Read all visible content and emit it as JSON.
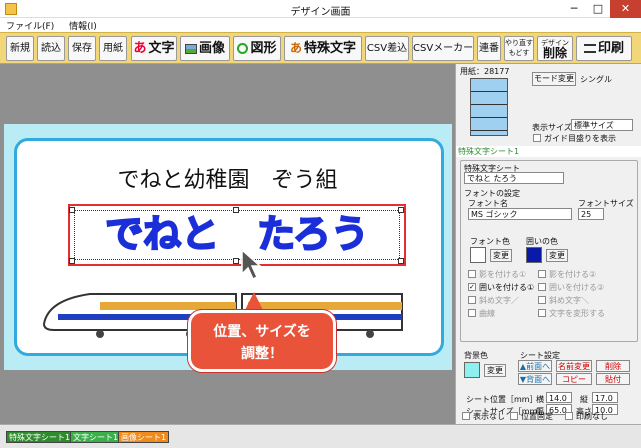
{
  "window": {
    "title": "デザイン画面",
    "minimize": "─",
    "maximize": "□",
    "close": "✕"
  },
  "menu": [
    "ファイル(F)",
    "情報(I)"
  ],
  "toolbar": {
    "new": "新規",
    "load": "読込",
    "save": "保存",
    "paper": "用紙",
    "text": "文字",
    "image": "画像",
    "shape": "図形",
    "special_text": "特殊文字",
    "csv_merge": "CSV差込",
    "csv_maker": "CSVメーカー",
    "serial": "連番",
    "undo": "やり直す",
    "redo": "もどす",
    "design_label": "デザイン",
    "delete": "削除",
    "print": "印刷"
  },
  "canvas": {
    "title_text": "でねと幼稚園　ぞう組",
    "name_text": "でねと　たろう",
    "callout_line1": "位置、サイズを",
    "callout_line2": "調整！"
  },
  "paper_info": {
    "label": "用紙：28177",
    "mode_button": "モード変更",
    "mode_value": "シングル",
    "display_size_label": "表示サイズ",
    "display_size_value": "標準サイズ",
    "guide_label": "ガイド目盛りを表示"
  },
  "panel": {
    "header": "特殊文字シート1",
    "sheet_label": "特殊文字シート",
    "sheet_value": "でねと たろう",
    "font_group": "フォントの設定",
    "font_name_label": "フォント名",
    "font_name_value": "MS ゴシック",
    "font_size_label": "フォントサイズ",
    "font_size_value": "25",
    "font_color_label": "フォント色",
    "border_color_label": "囲いの色",
    "change": "変更",
    "options": [
      "影を付ける①",
      "影を付ける②",
      "囲いを付ける①",
      "囲いを付ける②",
      "斜め文字／",
      "斜め文字＼",
      "曲線",
      "文字を変形する"
    ],
    "bg_label": "背景色",
    "sheet_settings": "シート設定",
    "front": "▲前面へ",
    "back": "▼背面へ",
    "rename": "名前変更",
    "copy": "コピー",
    "delete_btn": "削除",
    "paste": "貼付",
    "pos_label": "シート位置［mm］",
    "size_label": "シートサイズ［mm］",
    "x_label": "横",
    "x_value": "14.0",
    "y_label": "縦",
    "y_value": "17.0",
    "w_label": "幅",
    "w_value": "65.0",
    "h_label": "高さ",
    "h_value": "10.0",
    "hide_label": "表示なし",
    "fix_label": "位置固定",
    "noprint_label": "印刷なし"
  },
  "status_tabs": [
    "特殊文字シート1",
    "文字シート1",
    "画像シート1"
  ],
  "colors": {
    "toolbar": "#f2d77a",
    "name_text": "#1a2fd8",
    "border_color": "#0a1aa8",
    "bg_color": "#8ff0f0",
    "panel_header": "#2e8b2e"
  }
}
